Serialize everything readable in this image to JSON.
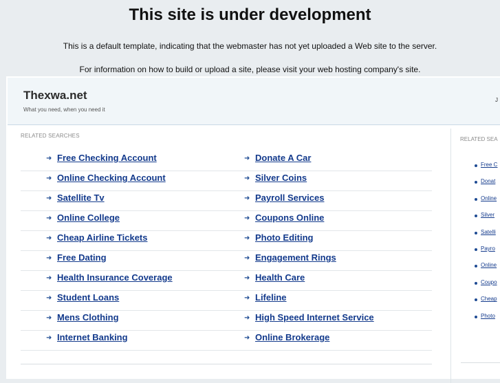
{
  "notice": {
    "title": "This site is under development",
    "line1": "This is a default template, indicating that the webmaster has not yet uploaded a Web site to the server.",
    "line2": "For information on how to build or upload a site, please visit your web hosting company's site."
  },
  "header": {
    "site_name": "Thexwa.net",
    "tagline": "What you need, when you need it",
    "right_text": "J"
  },
  "main": {
    "section_label": "RELATED SEARCHES",
    "left_links": [
      "Free Checking Account",
      "Online Checking Account",
      "Satellite Tv",
      "Online College",
      "Cheap Airline Tickets",
      "Free Dating",
      "Health Insurance Coverage",
      "Student Loans",
      "Mens Clothing",
      "Internet Banking"
    ],
    "right_links": [
      "Donate A Car",
      "Silver Coins",
      "Payroll Services",
      "Coupons Online",
      "Photo Editing",
      "Engagement Rings",
      "Health Care",
      "Lifeline",
      "High Speed Internet Service",
      "Online Brokerage"
    ]
  },
  "sidebar": {
    "section_label": "RELATED SEA",
    "items": [
      "Free C",
      "Donat",
      "Online",
      "Silver",
      "Satelli",
      "Payro",
      "Online",
      "Coupo",
      "Cheap",
      "Photo"
    ]
  },
  "colors": {
    "link": "#133a8c",
    "arrow": "#1e4b93",
    "header_bg": "#f1f6f9",
    "page_bg": "#e9edf0"
  },
  "icons": {
    "row_arrow": "arrow-right-icon",
    "sidebar_bullet": "bullet-icon"
  }
}
